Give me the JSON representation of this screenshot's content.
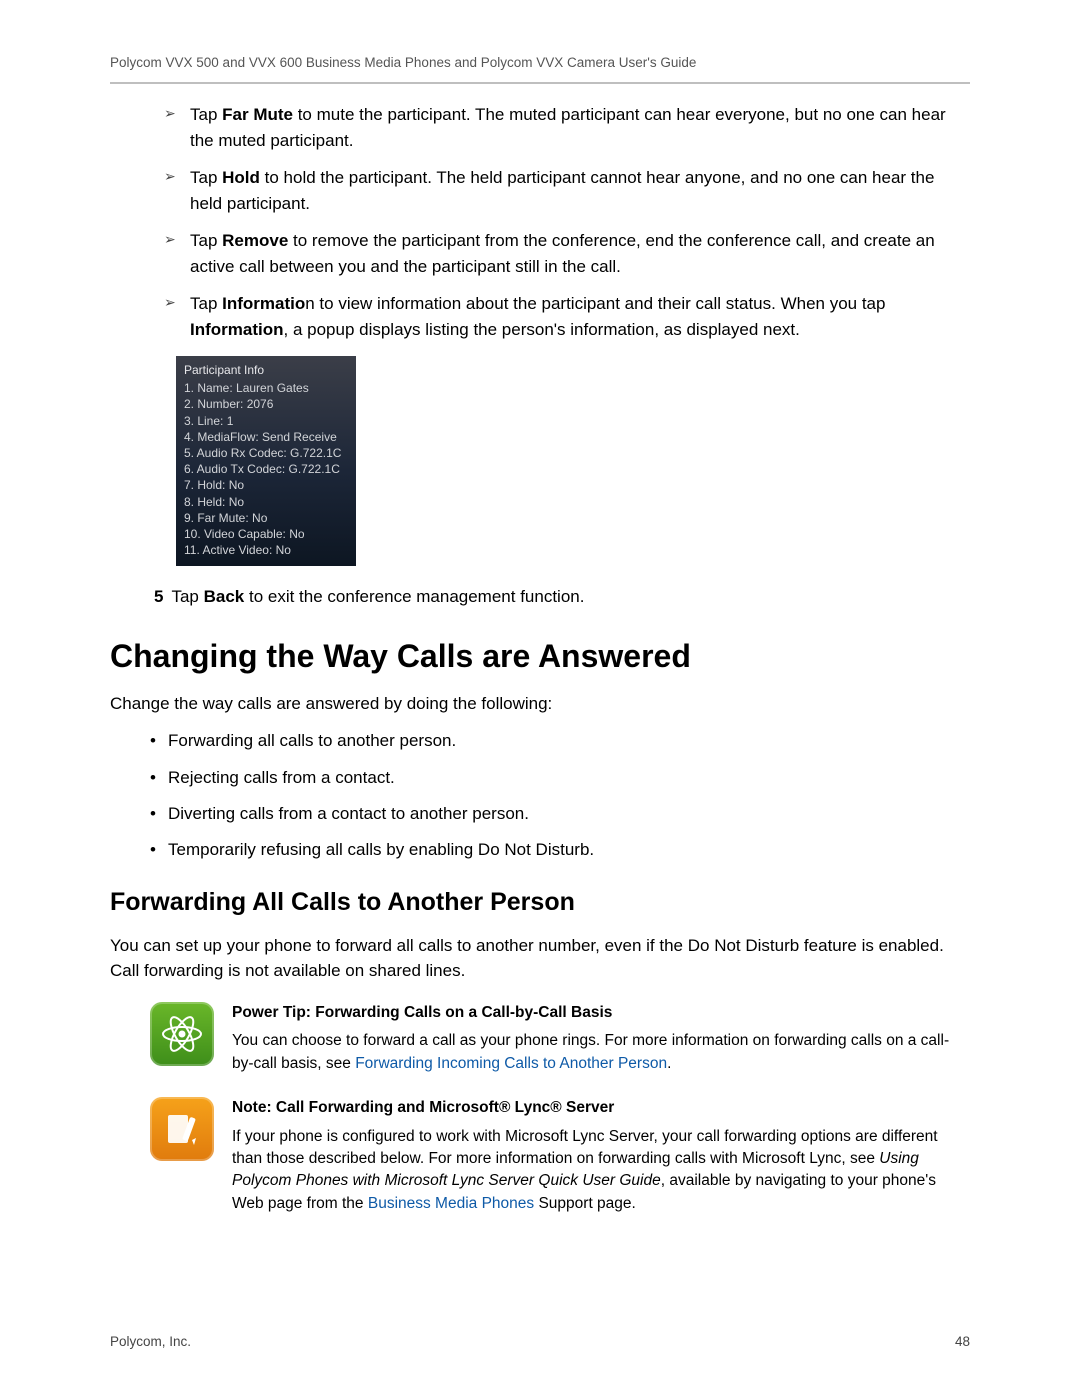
{
  "header": {
    "title": "Polycom VVX 500 and VVX 600 Business Media Phones and Polycom VVX Camera User's Guide"
  },
  "arrow_items": [
    {
      "pre": "Tap ",
      "bold": "Far Mute",
      "post": " to mute the participant. The muted participant can hear everyone, but no one can hear the muted participant."
    },
    {
      "pre": "Tap ",
      "bold": "Hold",
      "post": " to hold the participant. The held participant cannot hear anyone, and no one can hear the held participant."
    },
    {
      "pre": "Tap ",
      "bold": "Remove",
      "post": " to remove the participant from the conference, end the conference call, and create an active call between you and the participant still in the call."
    },
    {
      "pre": "Tap ",
      "bold": "Informatio",
      "post": "n to view information about the participant and their call status. When you tap ",
      "bold2": "Information",
      "post2": ", a popup displays listing the person's information, as displayed next."
    }
  ],
  "info_popup": {
    "title": "Participant Info",
    "lines": [
      "1. Name: Lauren Gates",
      "2. Number: 2076",
      "3. Line: 1",
      "4. MediaFlow: Send Receive",
      "5. Audio Rx Codec: G.722.1C",
      "6. Audio Tx Codec: G.722.1C",
      "7. Hold: No",
      "8. Held: No",
      "9. Far Mute: No",
      "10. Video Capable: No",
      "11. Active Video: No"
    ]
  },
  "step5": {
    "num": "5",
    "pre": "Tap ",
    "bold": "Back",
    "post": " to exit the conference management function."
  },
  "h1": "Changing the Way Calls are Answered",
  "intro": "Change the way calls are answered by doing the following:",
  "bullets": [
    "Forwarding all calls to another person.",
    "Rejecting calls from a contact.",
    "Diverting calls from a contact to another person.",
    "Temporarily refusing all calls by enabling Do Not Disturb."
  ],
  "h2": "Forwarding All Calls to Another Person",
  "h2_body": "You can set up your phone to forward all calls to another number, even if the Do Not Disturb feature is enabled. Call forwarding is not available on shared lines.",
  "tip": {
    "title": "Power Tip: Forwarding Calls on a Call-by-Call Basis",
    "body_pre": "You can choose to forward a call as your phone rings. For more information on forwarding calls on a call-by-call basis, see ",
    "link": "Forwarding Incoming Calls to Another Person",
    "body_post": "."
  },
  "note": {
    "title": "Note: Call Forwarding and Microsoft® Lync® Server",
    "body_pre": "If your phone is configured to work with Microsoft Lync Server, your call forwarding options are different than those described below. For more information on forwarding calls with Microsoft Lync, see ",
    "italic": "Using Polycom Phones with Microsoft Lync Server Quick User Guide",
    "body_mid": ", available by navigating to your phone's Web page from the ",
    "link": "Business Media Phones",
    "body_post": " Support page."
  },
  "footer": {
    "left": "Polycom, Inc.",
    "right": "48"
  }
}
